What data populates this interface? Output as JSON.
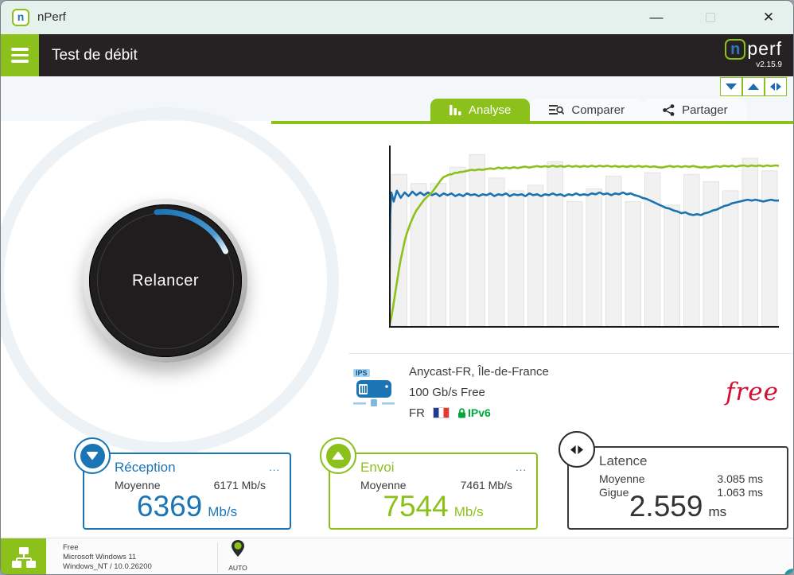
{
  "window": {
    "title": "nPerf",
    "controls": {
      "minimize": "—",
      "close": "✕"
    }
  },
  "header": {
    "title": "Test de débit",
    "brand": {
      "n": "n",
      "rest": "perf",
      "version": "v2.15.9"
    }
  },
  "tabs": [
    {
      "label": "Analyse",
      "active": true
    },
    {
      "label": "Comparer",
      "active": false
    },
    {
      "label": "Partager",
      "active": false
    }
  ],
  "mini_buttons": [
    {
      "name": "download-toggle"
    },
    {
      "name": "upload-toggle"
    },
    {
      "name": "latency-toggle"
    }
  ],
  "gauge": {
    "button_label": "Relancer"
  },
  "chart_data": {
    "type": "composite",
    "description": "nPerf speed test timeline: download bitrate (blue line), upload bitrate (green line), per-interval samples (gray bars). Values are percent of chart height; no axis labels are shown in the app.",
    "x_range": [
      0,
      100
    ],
    "y_range": [
      0,
      100
    ],
    "grid": false,
    "bar_color": "#f1f1f1",
    "bar_border": "#e3e3e3",
    "bars": [
      84,
      79,
      79,
      88,
      95,
      82,
      75,
      78,
      91,
      69,
      76,
      83,
      69,
      85,
      67,
      84,
      80,
      75,
      93,
      86
    ],
    "series": [
      {
        "name": "download",
        "color": "#1b72b0",
        "points": [
          [
            0,
            0
          ],
          [
            0.3,
            62
          ],
          [
            0.6,
            74
          ],
          [
            1.2,
            69
          ],
          [
            2,
            75
          ],
          [
            3,
            71
          ],
          [
            4,
            74
          ],
          [
            5,
            72
          ],
          [
            6,
            74.5
          ],
          [
            7,
            72.5
          ],
          [
            8,
            74
          ],
          [
            9,
            72.5
          ],
          [
            10,
            74
          ],
          [
            11,
            72.5
          ],
          [
            12,
            73.5
          ],
          [
            13,
            72
          ],
          [
            14,
            73.5
          ],
          [
            15,
            72.5
          ],
          [
            16,
            73.5
          ],
          [
            17,
            72
          ],
          [
            18,
            73
          ],
          [
            19,
            72
          ],
          [
            20,
            73.5
          ],
          [
            21,
            72.5
          ],
          [
            22,
            73
          ],
          [
            23,
            72
          ],
          [
            24,
            73
          ],
          [
            25,
            72.5
          ],
          [
            26,
            73.5
          ],
          [
            27,
            72
          ],
          [
            28,
            73
          ],
          [
            29,
            72.5
          ],
          [
            30,
            73.5
          ],
          [
            31,
            72
          ],
          [
            32,
            73
          ],
          [
            33,
            72.5
          ],
          [
            34,
            73
          ],
          [
            35,
            72
          ],
          [
            36,
            73.5
          ],
          [
            37,
            72.5
          ],
          [
            38,
            73
          ],
          [
            39,
            72
          ],
          [
            40,
            73
          ],
          [
            41,
            72.5
          ],
          [
            42,
            73.5
          ],
          [
            43,
            72.5
          ],
          [
            44,
            73
          ],
          [
            45,
            72
          ],
          [
            46,
            73
          ],
          [
            47,
            72.5
          ],
          [
            48,
            73.5
          ],
          [
            49,
            72.5
          ],
          [
            50,
            73
          ],
          [
            51,
            72.5
          ],
          [
            52,
            73.5
          ],
          [
            53,
            73
          ],
          [
            54,
            74
          ],
          [
            55,
            73
          ],
          [
            56,
            73.5
          ],
          [
            57,
            72.5
          ],
          [
            58,
            73.5
          ],
          [
            59,
            73
          ],
          [
            60,
            74
          ],
          [
            61,
            73
          ],
          [
            62,
            73.5
          ],
          [
            63,
            72.5
          ],
          [
            64,
            72
          ],
          [
            65,
            71
          ],
          [
            66,
            70.5
          ],
          [
            67,
            69.5
          ],
          [
            68,
            68.5
          ],
          [
            69,
            67.5
          ],
          [
            70,
            66.5
          ],
          [
            71,
            65.5
          ],
          [
            72,
            65
          ],
          [
            73,
            64
          ],
          [
            74,
            63.5
          ],
          [
            75,
            62.5
          ],
          [
            76,
            63
          ],
          [
            77,
            62
          ],
          [
            78,
            61.5
          ],
          [
            79,
            62
          ],
          [
            80,
            61.5
          ],
          [
            81,
            62.5
          ],
          [
            82,
            63
          ],
          [
            83,
            64
          ],
          [
            84,
            64.5
          ],
          [
            85,
            65.5
          ],
          [
            86,
            66.5
          ],
          [
            87,
            67
          ],
          [
            88,
            68
          ],
          [
            89,
            68.5
          ],
          [
            90,
            69
          ],
          [
            91,
            69.5
          ],
          [
            92,
            70
          ],
          [
            93,
            69.5
          ],
          [
            94,
            70
          ],
          [
            95,
            69.5
          ],
          [
            96,
            69
          ],
          [
            97,
            69.5
          ],
          [
            98,
            70
          ],
          [
            99,
            69.5
          ],
          [
            100,
            69.5
          ]
        ]
      },
      {
        "name": "upload",
        "color": "#8cc11c",
        "points": [
          [
            0,
            0
          ],
          [
            0.5,
            4
          ],
          [
            1,
            10
          ],
          [
            1.5,
            17
          ],
          [
            2,
            24
          ],
          [
            2.5,
            31
          ],
          [
            3,
            37
          ],
          [
            3.5,
            42
          ],
          [
            4,
            47
          ],
          [
            4.5,
            51
          ],
          [
            5,
            54
          ],
          [
            5.5,
            57
          ],
          [
            6,
            59.5
          ],
          [
            6.5,
            62
          ],
          [
            7,
            64
          ],
          [
            7.5,
            65.5
          ],
          [
            8,
            67
          ],
          [
            8.5,
            68.5
          ],
          [
            9,
            70
          ],
          [
            9.5,
            71
          ],
          [
            10,
            72
          ],
          [
            10.5,
            73
          ],
          [
            11,
            74
          ],
          [
            11.5,
            75.5
          ],
          [
            12,
            77
          ],
          [
            12.5,
            78.5
          ],
          [
            13,
            80
          ],
          [
            13.5,
            81.5
          ],
          [
            14,
            82.5
          ],
          [
            14.5,
            83
          ],
          [
            15,
            83.5
          ],
          [
            15.5,
            84
          ],
          [
            16,
            84
          ],
          [
            16.5,
            84.5
          ],
          [
            17,
            85
          ],
          [
            17.5,
            84.8
          ],
          [
            18,
            85.3
          ],
          [
            19,
            85.5
          ],
          [
            20,
            86
          ],
          [
            21,
            86.5
          ],
          [
            22,
            86.3
          ],
          [
            23,
            86.8
          ],
          [
            24,
            86.5
          ],
          [
            25,
            87
          ],
          [
            26,
            87.3
          ],
          [
            27,
            87
          ],
          [
            28,
            87.8
          ],
          [
            29,
            87.3
          ],
          [
            30,
            87.8
          ],
          [
            31,
            87.4
          ],
          [
            32,
            88
          ],
          [
            33,
            87.5
          ],
          [
            34,
            88
          ],
          [
            35,
            88.3
          ],
          [
            36,
            87.8
          ],
          [
            37,
            88.3
          ],
          [
            38,
            88.6
          ],
          [
            39,
            88.2
          ],
          [
            40,
            88.6
          ],
          [
            41,
            88.2
          ],
          [
            42,
            88.8
          ],
          [
            43,
            88.3
          ],
          [
            44,
            88.7
          ],
          [
            45,
            88.2
          ],
          [
            46,
            88.8
          ],
          [
            47,
            88.3
          ],
          [
            48,
            88.7
          ],
          [
            49,
            88.2
          ],
          [
            50,
            88.7
          ],
          [
            51,
            88.3
          ],
          [
            52,
            88.8
          ],
          [
            53,
            88.3
          ],
          [
            54,
            88.8
          ],
          [
            55,
            88.4
          ],
          [
            56,
            88.8
          ],
          [
            57,
            88.3
          ],
          [
            58,
            88.7
          ],
          [
            59,
            88.2
          ],
          [
            60,
            88.6
          ],
          [
            61,
            88.2
          ],
          [
            62,
            88.7
          ],
          [
            63,
            88.3
          ],
          [
            64,
            88.7
          ],
          [
            65,
            88.2
          ],
          [
            66,
            88.6
          ],
          [
            67,
            88.1
          ],
          [
            68,
            88.5
          ],
          [
            69,
            88
          ],
          [
            70,
            87.8
          ],
          [
            71,
            88.3
          ],
          [
            72,
            88.7
          ],
          [
            73,
            88.2
          ],
          [
            74,
            88.6
          ],
          [
            75,
            88.1
          ],
          [
            76,
            88.6
          ],
          [
            77,
            88.2
          ],
          [
            78,
            88.7
          ],
          [
            79,
            88.2
          ],
          [
            80,
            87.8
          ],
          [
            81,
            88.2
          ],
          [
            82,
            87.8
          ],
          [
            83,
            88.3
          ],
          [
            84,
            88.6
          ],
          [
            85,
            88.2
          ],
          [
            86,
            88.8
          ],
          [
            87,
            88.4
          ],
          [
            88,
            88.8
          ],
          [
            89,
            88.3
          ],
          [
            90,
            88.8
          ],
          [
            91,
            89
          ],
          [
            92,
            88.5
          ],
          [
            93,
            89
          ],
          [
            94,
            88.6
          ],
          [
            95,
            89
          ],
          [
            96,
            88.5
          ],
          [
            97,
            89
          ],
          [
            98,
            88.6
          ],
          [
            99,
            89
          ],
          [
            100,
            88.8
          ]
        ]
      }
    ]
  },
  "server": {
    "ips_label": "IPS",
    "name": "Anycast-FR, Île-de-France",
    "bandwidth": "100 Gb/s Free",
    "country": "FR",
    "ip_badge": "IPv6",
    "provider_logo": "free"
  },
  "cards": {
    "reception": {
      "title": "Réception",
      "menu": "...",
      "avg_label": "Moyenne",
      "avg_value": "6171 Mb/s",
      "value": "6369",
      "unit": "Mb/s"
    },
    "envoi": {
      "title": "Envoi",
      "menu": "...",
      "avg_label": "Moyenne",
      "avg_value": "7461 Mb/s",
      "value": "7544",
      "unit": "Mb/s"
    },
    "latence": {
      "title": "Latence",
      "avg_label": "Moyenne",
      "avg_value": "3.085 ms",
      "jitter_label": "Gigue",
      "jitter_value": "1.063 ms",
      "value": "2.559",
      "unit": "ms"
    }
  },
  "statusbar": {
    "isp": "Free",
    "os": "Microsoft Windows 11",
    "platform": "Windows_NT / 10.0.26200",
    "server_mode": "AUTO"
  },
  "colors": {
    "green": "#8cc11c",
    "blue": "#1b75b5",
    "dark_header": "#262223",
    "brand_red": "#d11033"
  }
}
